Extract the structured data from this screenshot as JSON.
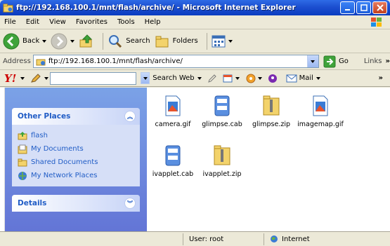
{
  "window": {
    "title": "ftp://192.168.100.1/mnt/flash/archive/ - Microsoft Internet Explorer"
  },
  "menu": {
    "items": [
      "File",
      "Edit",
      "View",
      "Favorites",
      "Tools",
      "Help"
    ]
  },
  "toolbar": {
    "back_label": "Back",
    "search_label": "Search",
    "folders_label": "Folders"
  },
  "address": {
    "label": "Address",
    "value": "ftp://192.168.100.1/mnt/flash/archive/",
    "go_label": "Go",
    "links_label": "Links"
  },
  "yahoo": {
    "logo": "Y!",
    "search_input": "",
    "search_web_label": "Search Web",
    "mail_label": "Mail"
  },
  "taskpane": {
    "other_places": {
      "title": "Other Places",
      "items": [
        {
          "label": "flash",
          "icon": "folder-up-icon"
        },
        {
          "label": "My Documents",
          "icon": "my-documents-icon"
        },
        {
          "label": "Shared Documents",
          "icon": "folder-icon"
        },
        {
          "label": "My Network Places",
          "icon": "network-places-icon"
        }
      ]
    },
    "details": {
      "title": "Details"
    }
  },
  "files": [
    {
      "name": "camera.gif",
      "icon": "gif-file-icon"
    },
    {
      "name": "glimpse.cab",
      "icon": "cab-file-icon"
    },
    {
      "name": "glimpse.zip",
      "icon": "zip-file-icon"
    },
    {
      "name": "imagemap.gif",
      "icon": "gif-file-icon"
    },
    {
      "name": "ivapplet.cab",
      "icon": "cab-file-icon"
    },
    {
      "name": "ivapplet.zip",
      "icon": "zip-file-icon"
    }
  ],
  "status": {
    "user": "User: root",
    "zone": "Internet"
  },
  "colors": {
    "title_bar": "#1C4FD0",
    "taskpane": "#6F8BDD",
    "link_blue": "#215DC6"
  }
}
